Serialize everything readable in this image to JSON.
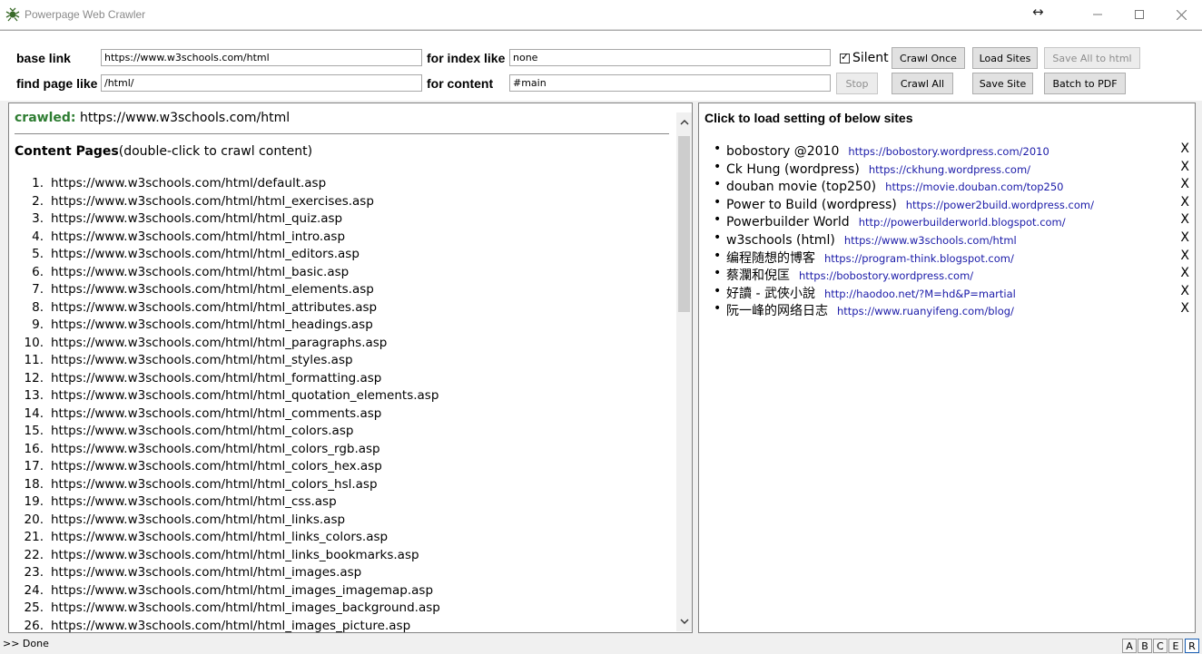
{
  "window": {
    "title": "Powerpage Web Crawler"
  },
  "toolbar": {
    "base_link_label": "base link",
    "base_link_value": "https://www.w3schools.com/html",
    "find_page_label": "find page like",
    "find_page_value": "/html/",
    "index_like_label": "for index like",
    "index_like_value": "none",
    "content_label": "for content",
    "content_value": "#main",
    "silent_label": "Silent",
    "silent_checked": true,
    "crawl_once": "Crawl Once",
    "load_sites": "Load Sites",
    "save_all_html": "Save All to html",
    "stop": "Stop",
    "crawl_all": "Crawl All",
    "save_site": "Save Site",
    "batch_pdf": "Batch to PDF"
  },
  "left": {
    "crawled_label": "crawled:",
    "crawled_url": "https://www.w3schools.com/html",
    "content_title": "Content Pages",
    "content_hint": "(double-click to crawl content)",
    "pages": [
      "https://www.w3schools.com/html/default.asp",
      "https://www.w3schools.com/html/html_exercises.asp",
      "https://www.w3schools.com/html/html_quiz.asp",
      "https://www.w3schools.com/html/html_intro.asp",
      "https://www.w3schools.com/html/html_editors.asp",
      "https://www.w3schools.com/html/html_basic.asp",
      "https://www.w3schools.com/html/html_elements.asp",
      "https://www.w3schools.com/html/html_attributes.asp",
      "https://www.w3schools.com/html/html_headings.asp",
      "https://www.w3schools.com/html/html_paragraphs.asp",
      "https://www.w3schools.com/html/html_styles.asp",
      "https://www.w3schools.com/html/html_formatting.asp",
      "https://www.w3schools.com/html/html_quotation_elements.asp",
      "https://www.w3schools.com/html/html_comments.asp",
      "https://www.w3schools.com/html/html_colors.asp",
      "https://www.w3schools.com/html/html_colors_rgb.asp",
      "https://www.w3schools.com/html/html_colors_hex.asp",
      "https://www.w3schools.com/html/html_colors_hsl.asp",
      "https://www.w3schools.com/html/html_css.asp",
      "https://www.w3schools.com/html/html_links.asp",
      "https://www.w3schools.com/html/html_links_colors.asp",
      "https://www.w3schools.com/html/html_links_bookmarks.asp",
      "https://www.w3schools.com/html/html_images.asp",
      "https://www.w3schools.com/html/html_images_imagemap.asp",
      "https://www.w3schools.com/html/html_images_background.asp",
      "https://www.w3schools.com/html/html_images_picture.asp"
    ]
  },
  "right": {
    "title": "Click to load setting of below sites",
    "sites": [
      {
        "name": "bobostory @2010",
        "url": "https://bobostory.wordpress.com/2010"
      },
      {
        "name": "Ck Hung (wordpress)",
        "url": "https://ckhung.wordpress.com/"
      },
      {
        "name": "douban movie (top250)",
        "url": "https://movie.douban.com/top250"
      },
      {
        "name": "Power to Build (wordpress)",
        "url": "https://power2build.wordpress.com/"
      },
      {
        "name": "Powerbuilder World",
        "url": "http://powerbuilderworld.blogspot.com/"
      },
      {
        "name": "w3schools (html)",
        "url": "https://www.w3schools.com/html"
      },
      {
        "name": "编程随想的博客",
        "url": "https://program-think.blogspot.com/"
      },
      {
        "name": "蔡瀾和倪匡",
        "url": "https://bobostory.wordpress.com/"
      },
      {
        "name": "好讀 - 武俠小說",
        "url": "http://haodoo.net/?M=hd&P=martial"
      },
      {
        "name": "阮一峰的网络日志",
        "url": "https://www.ruanyifeng.com/blog/"
      }
    ],
    "remove_label": "X"
  },
  "status": {
    "text": ">> Done",
    "keys": [
      "A",
      "B",
      "C",
      "E",
      "R"
    ]
  },
  "colors": {
    "crawled_label": "#2e7d32",
    "link": "#1a1aa8"
  }
}
